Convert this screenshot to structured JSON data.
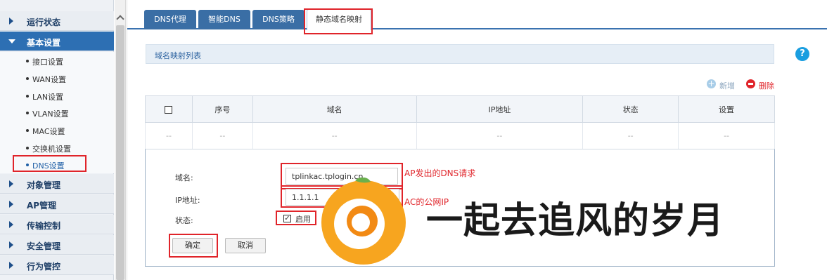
{
  "sidebar": {
    "items": [
      {
        "label": "运行状态"
      },
      {
        "label": "基本设置"
      },
      {
        "label": "对象管理"
      },
      {
        "label": "AP管理"
      },
      {
        "label": "传输控制"
      },
      {
        "label": "安全管理"
      },
      {
        "label": "行为管控"
      }
    ],
    "sub_items": [
      {
        "label": "接口设置"
      },
      {
        "label": "WAN设置"
      },
      {
        "label": "LAN设置"
      },
      {
        "label": "VLAN设置"
      },
      {
        "label": "MAC设置"
      },
      {
        "label": "交换机设置"
      },
      {
        "label": "DNS设置"
      }
    ]
  },
  "tabs": [
    {
      "label": "DNS代理"
    },
    {
      "label": "智能DNS"
    },
    {
      "label": "DNS策略"
    },
    {
      "label": "静态域名映射"
    }
  ],
  "help_icon": "?",
  "list": {
    "title": "域名映射列表",
    "add_label": "新增",
    "delete_label": "删除",
    "columns": [
      "序号",
      "域名",
      "IP地址",
      "状态",
      "设置"
    ],
    "empty_row": [
      "--",
      "--",
      "--",
      "--",
      "--",
      "--"
    ]
  },
  "form": {
    "domain_label": "域名:",
    "domain_value": "tplinkac.tplogin.cn",
    "ip_label": "IP地址:",
    "ip_value": "1.1.1.1",
    "status_label": "状态:",
    "enable_label": "启用",
    "enable_checked": "✓",
    "confirm_label": "确定",
    "cancel_label": "取消"
  },
  "annotations": {
    "domain_note": "AP发出的DNS请求",
    "ip_note": "AC的公网IP"
  },
  "watermark": {
    "text": "一起去追风的岁月"
  },
  "colors": {
    "accent": "#2d6fb3",
    "annotation": "#e0242a",
    "tab": "#3a6ea5"
  }
}
